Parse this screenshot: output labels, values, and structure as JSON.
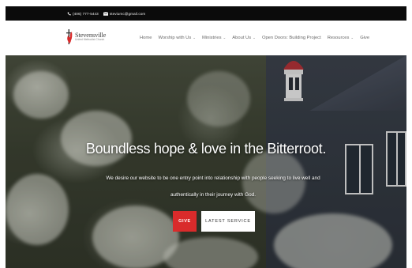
{
  "topbar": {
    "phone": "(406) 777-5443",
    "email": "steviumc@gmail.com"
  },
  "logo": {
    "name": "Stevensville",
    "subtitle": "United Methodist Church"
  },
  "nav": {
    "items": [
      {
        "label": "Home",
        "dropdown": false
      },
      {
        "label": "Worship with Us",
        "dropdown": true
      },
      {
        "label": "Ministries",
        "dropdown": true
      },
      {
        "label": "About Us",
        "dropdown": true
      },
      {
        "label": "Open Doors: Building Project",
        "dropdown": false
      },
      {
        "label": "Resources",
        "dropdown": true
      },
      {
        "label": "Give",
        "dropdown": false
      }
    ],
    "chevron": "⌄"
  },
  "hero": {
    "title": "Boundless hope & love in the Bitterroot.",
    "text": "We desire our website to be one entry point into relationship with people seeking to live well and authentically in their journey with God.",
    "give_label": "GIVE",
    "service_label": "LATEST SERVICE"
  },
  "colors": {
    "accent": "#d92b2b",
    "topbar": "#0b0b0b"
  }
}
